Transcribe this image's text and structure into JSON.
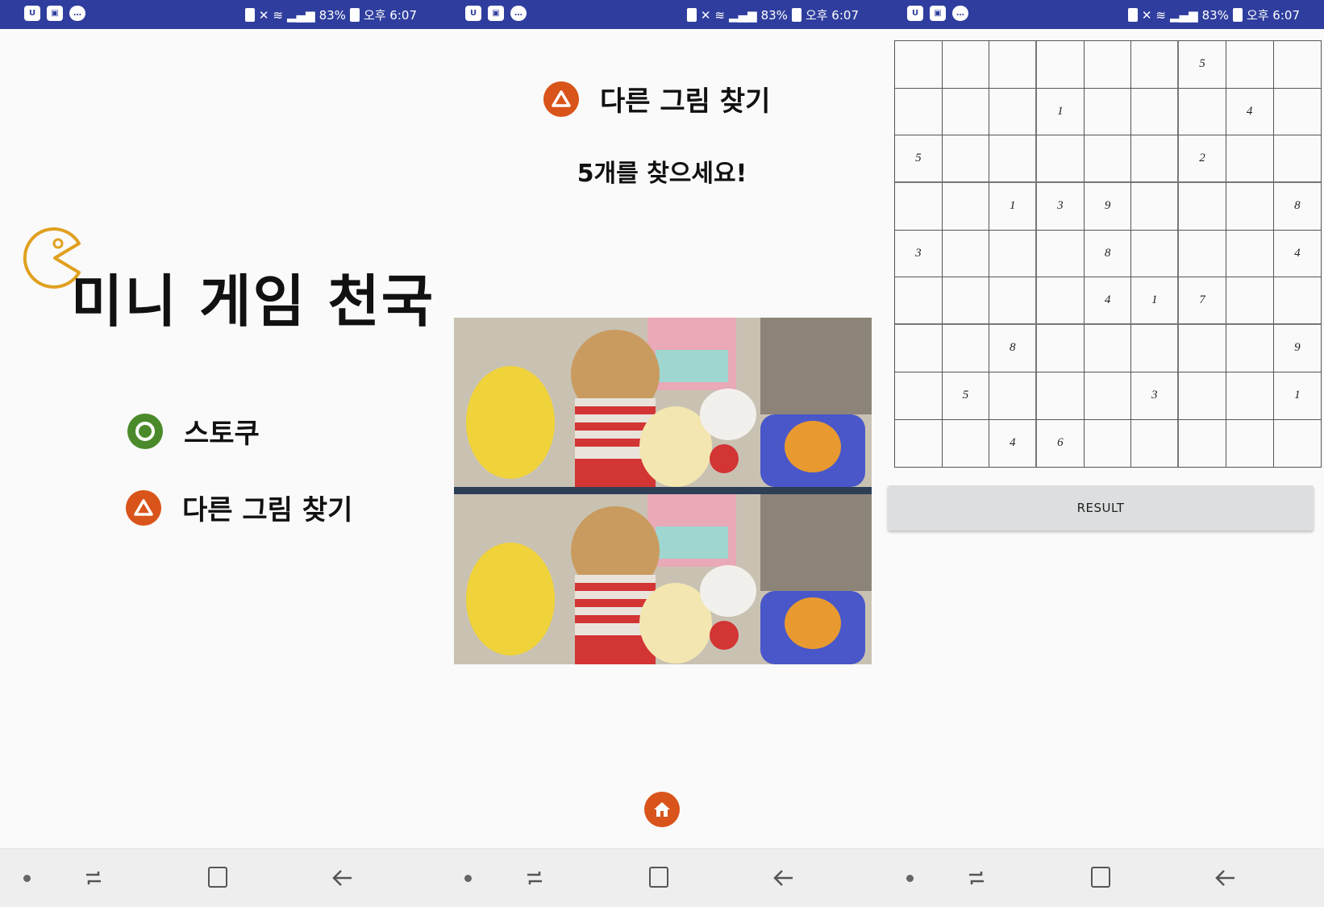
{
  "status_bar": {
    "battery": "83%",
    "time": "오후 6:07"
  },
  "screen_main": {
    "title": "미니 게임 천국",
    "menu": [
      {
        "label": "스토쿠",
        "icon": "circle-icon",
        "color": "#4a8a2a"
      },
      {
        "label": "다른 그림 찾기",
        "icon": "triangle-icon",
        "color": "#d9541a"
      }
    ]
  },
  "screen_spot": {
    "title": "다른 그림 찾기",
    "instruction": "5개를 찾으세요!",
    "home_icon": "home-icon",
    "accent": "#d9541a"
  },
  "screen_sudoku": {
    "grid": [
      [
        "",
        "",
        "",
        "",
        "",
        "",
        "5",
        "",
        ""
      ],
      [
        "",
        "",
        "",
        "1",
        "",
        "",
        "",
        "4",
        ""
      ],
      [
        "5",
        "",
        "",
        "",
        "",
        "",
        "2",
        "",
        ""
      ],
      [
        "",
        "",
        "1",
        "3",
        "9",
        "",
        "",
        "",
        "8"
      ],
      [
        "3",
        "",
        "",
        "",
        "8",
        "",
        "",
        "",
        "4"
      ],
      [
        "",
        "",
        "",
        "",
        "4",
        "1",
        "7",
        "",
        ""
      ],
      [
        "",
        "",
        "8",
        "",
        "",
        "",
        "",
        "",
        "9"
      ],
      [
        "",
        "5",
        "",
        "",
        "",
        "3",
        "",
        "",
        "1"
      ],
      [
        "",
        "",
        "4",
        "6",
        "",
        "",
        "",
        "",
        ""
      ]
    ],
    "result_label": "RESULT"
  }
}
